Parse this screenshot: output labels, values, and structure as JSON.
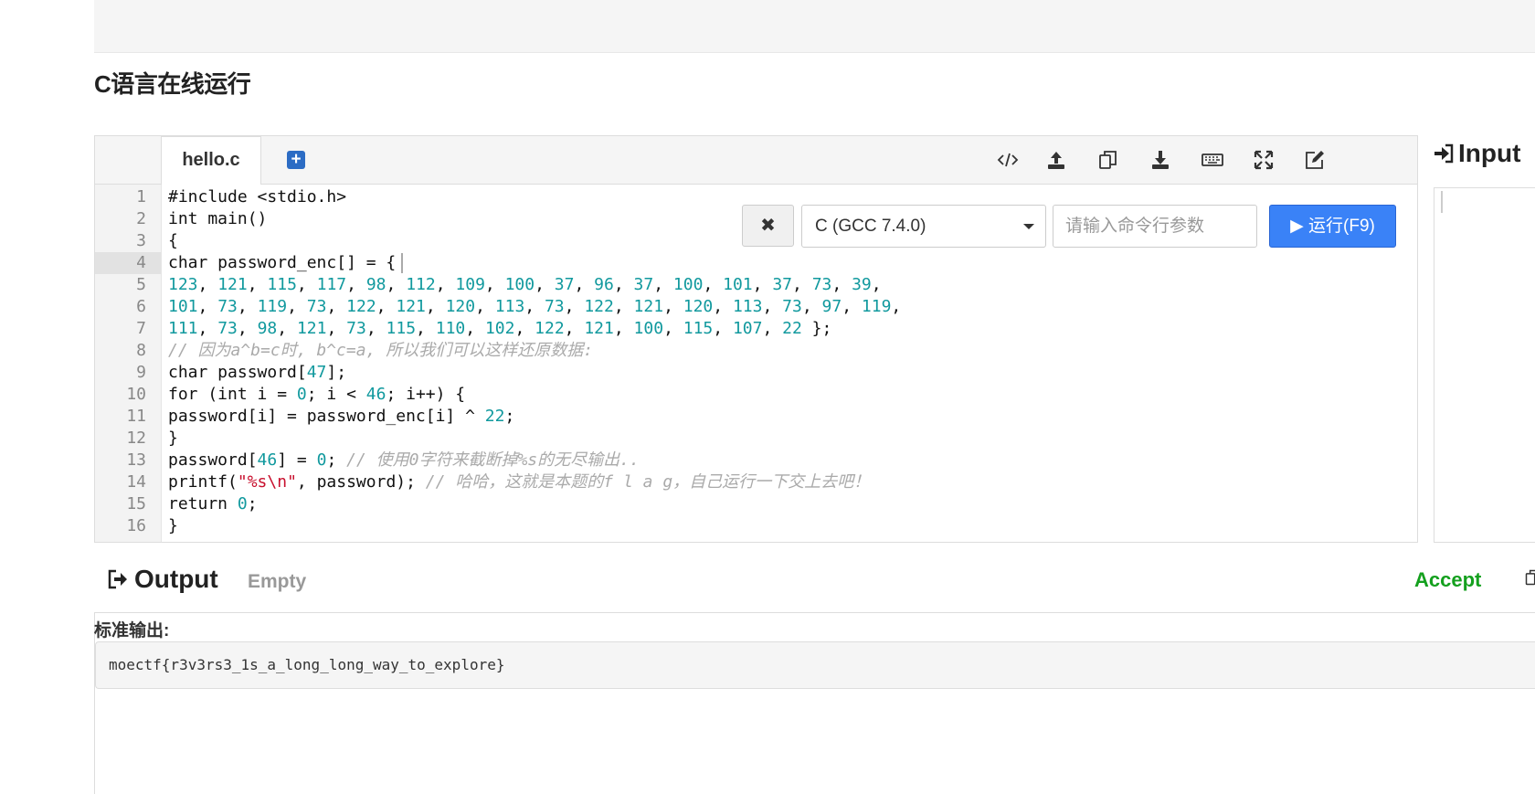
{
  "page": {
    "title": "C语言在线运行"
  },
  "editor": {
    "tab_label": "hello.c",
    "add_tab": "+",
    "tools": [
      "code-icon",
      "upload-icon",
      "copy-icon",
      "download-icon",
      "keyboard-icon",
      "fullscreen-icon",
      "edit-icon"
    ],
    "line_numbers": [
      "1",
      "2",
      "3",
      "4",
      "5",
      "6",
      "7",
      "8",
      "9",
      "10",
      "11",
      "12",
      "13",
      "14",
      "15",
      "16"
    ],
    "active_line": 4
  },
  "controls": {
    "stop_symbol": "✖",
    "language": "C (GCC 7.4.0)",
    "args_placeholder": "请输入命令行参数",
    "run_label": "▶ 运行(F9)"
  },
  "input_panel": {
    "title": "Input",
    "icon": "sign-in-icon"
  },
  "output": {
    "title": "Output",
    "status": "Empty",
    "accept_label": "Accept",
    "stdout_label": "标准输出:",
    "stdout_text": "moectf{r3v3rs3_1s_a_long_long_way_to_explore}"
  },
  "code": {
    "l1": "#include <stdio.h>",
    "l2": "int main()",
    "l3": "{",
    "l4": "char password_enc[] = {",
    "l5": [
      "123",
      "121",
      "115",
      "117",
      "98",
      "112",
      "109",
      "100",
      "37",
      "96",
      "37",
      "100",
      "101",
      "37",
      "73",
      "39"
    ],
    "l6": [
      "101",
      "73",
      "119",
      "73",
      "122",
      "121",
      "120",
      "113",
      "73",
      "122",
      "121",
      "120",
      "113",
      "73",
      "97",
      "119"
    ],
    "l7": [
      "111",
      "73",
      "98",
      "121",
      "73",
      "115",
      "110",
      "102",
      "122",
      "121",
      "100",
      "115",
      "107",
      "22"
    ],
    "l7_end": " };",
    "l8": "// 因为a^b=c时, b^c=a, 所以我们可以这样还原数据:",
    "l9a": "char password[",
    "l9n": "47",
    "l9b": "];",
    "l10a": "for (int i = ",
    "l10n1": "0",
    "l10b": "; i < ",
    "l10n2": "46",
    "l10c": "; i++) {",
    "l11a": "password[i] = password_enc[i] ^ ",
    "l11n": "22",
    "l11b": ";",
    "l12": "}",
    "l13a": "password[",
    "l13n1": "46",
    "l13b": "] = ",
    "l13n2": "0",
    "l13c": "; ",
    "l13cmt": "// 使用0字符来截断掉%s的无尽输出..",
    "l14a": "printf(",
    "l14s1": "\"",
    "l14s2": "%s",
    "l14s3": "\\n\"",
    "l14b": ", password); ",
    "l14cmt": "// 哈哈，这就是本题的f l a g，自己运行一下交上去吧！",
    "l15a": "return ",
    "l15n": "0",
    "l15b": ";",
    "l16": "}"
  }
}
